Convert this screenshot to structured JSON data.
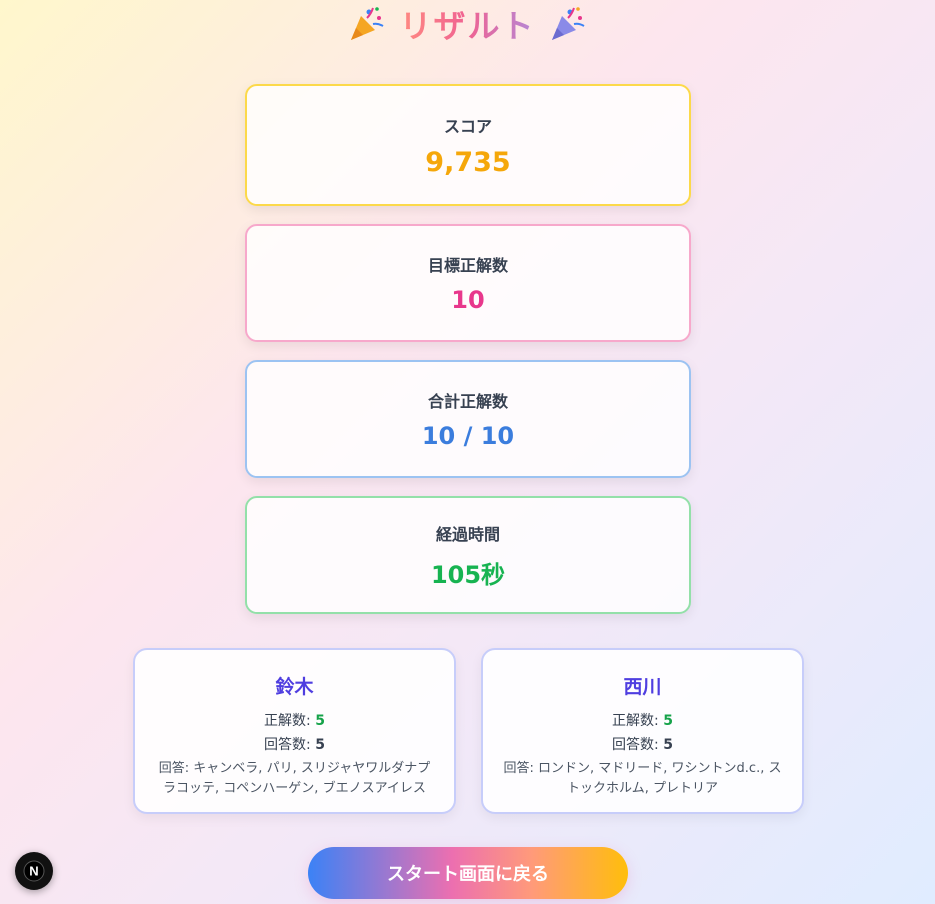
{
  "header": {
    "title": "リザルト",
    "icon_left": "party-popper-icon",
    "icon_right": "party-popper-icon"
  },
  "stats": {
    "score": {
      "label": "スコア",
      "value": "9,735",
      "color": "#f5a70a",
      "border": "#fcd94a"
    },
    "target": {
      "label": "目標正解数",
      "value": "10",
      "color": "#e8378c",
      "border": "#f7a8cb"
    },
    "total": {
      "label": "合計正解数",
      "value": "10 / 10",
      "color": "#3b7ddd",
      "border": "#9cc3f2"
    },
    "elapsed": {
      "label": "経過時間",
      "value": "105秒",
      "color": "#17b351",
      "border": "#93e0a9"
    }
  },
  "players": [
    {
      "name": "鈴木",
      "correct_label": "正解数:",
      "correct": "5",
      "answered_label": "回答数:",
      "answered": "5",
      "answers": "回答: キャンベラ, パリ, スリジャヤワルダナプラコッテ, コペンハーゲン, ブエノスアイレス"
    },
    {
      "name": "西川",
      "correct_label": "正解数:",
      "correct": "5",
      "answered_label": "回答数:",
      "answered": "5",
      "answers": "回答: ロンドン, マドリード, ワシントンd.c., ストックホルム, プレトリア"
    }
  ],
  "actions": {
    "back_label": "スタート画面に戻る"
  },
  "devtools": {
    "badge_letter": "N"
  },
  "colors": {
    "correct_count": "#16a34a",
    "player_name": "#4f3ee0"
  }
}
